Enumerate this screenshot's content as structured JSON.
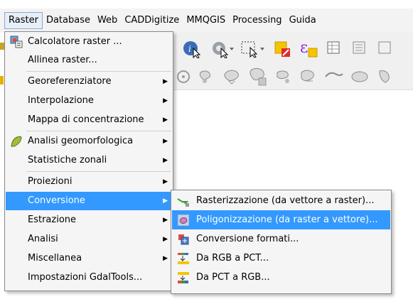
{
  "menubar": {
    "items": [
      "Raster",
      "Database",
      "Web",
      "CADDigitize",
      "MMQGIS",
      "Processing",
      "Guida"
    ],
    "active": "Raster"
  },
  "raster_menu": {
    "items": [
      {
        "label": "Calcolatore raster ...",
        "icon": "raster-calculator-icon",
        "submenu": false
      },
      {
        "label": "Allinea raster...",
        "icon": "",
        "submenu": false
      },
      {
        "label": "Georeferenziatore",
        "icon": "",
        "submenu": true
      },
      {
        "label": "Interpolazione",
        "icon": "",
        "submenu": true
      },
      {
        "label": "Mappa di concentrazione",
        "icon": "",
        "submenu": true
      },
      {
        "label": "Analisi geomorfologica",
        "icon": "terrain-analysis-icon",
        "submenu": true
      },
      {
        "label": "Statistiche zonali",
        "icon": "",
        "submenu": true
      },
      {
        "label": "Proiezioni",
        "icon": "",
        "submenu": true
      },
      {
        "label": "Conversione",
        "icon": "",
        "submenu": true,
        "selected": true
      },
      {
        "label": "Estrazione",
        "icon": "",
        "submenu": true
      },
      {
        "label": "Analisi",
        "icon": "",
        "submenu": true
      },
      {
        "label": "Miscellanea",
        "icon": "",
        "submenu": true
      },
      {
        "label": "Impostazioni GdalTools...",
        "icon": "",
        "submenu": false
      }
    ]
  },
  "conversion_submenu": {
    "items": [
      {
        "label": "Rasterizzazione (da vettore a raster)...",
        "icon": "rasterize-icon"
      },
      {
        "label": "Poligonizzazione (da raster a vettore)...",
        "icon": "polygonize-icon",
        "selected": true
      },
      {
        "label": "Conversione formati...",
        "icon": "translate-format-icon"
      },
      {
        "label": "Da RGB a PCT...",
        "icon": "rgb-to-pct-icon"
      },
      {
        "label": "Da PCT a RGB...",
        "icon": "pct-to-rgb-icon"
      }
    ]
  },
  "colors": {
    "selection": "#3399ff",
    "menu_bg": "#f5f5f5",
    "menubar_bg": "#f3f3f3"
  }
}
